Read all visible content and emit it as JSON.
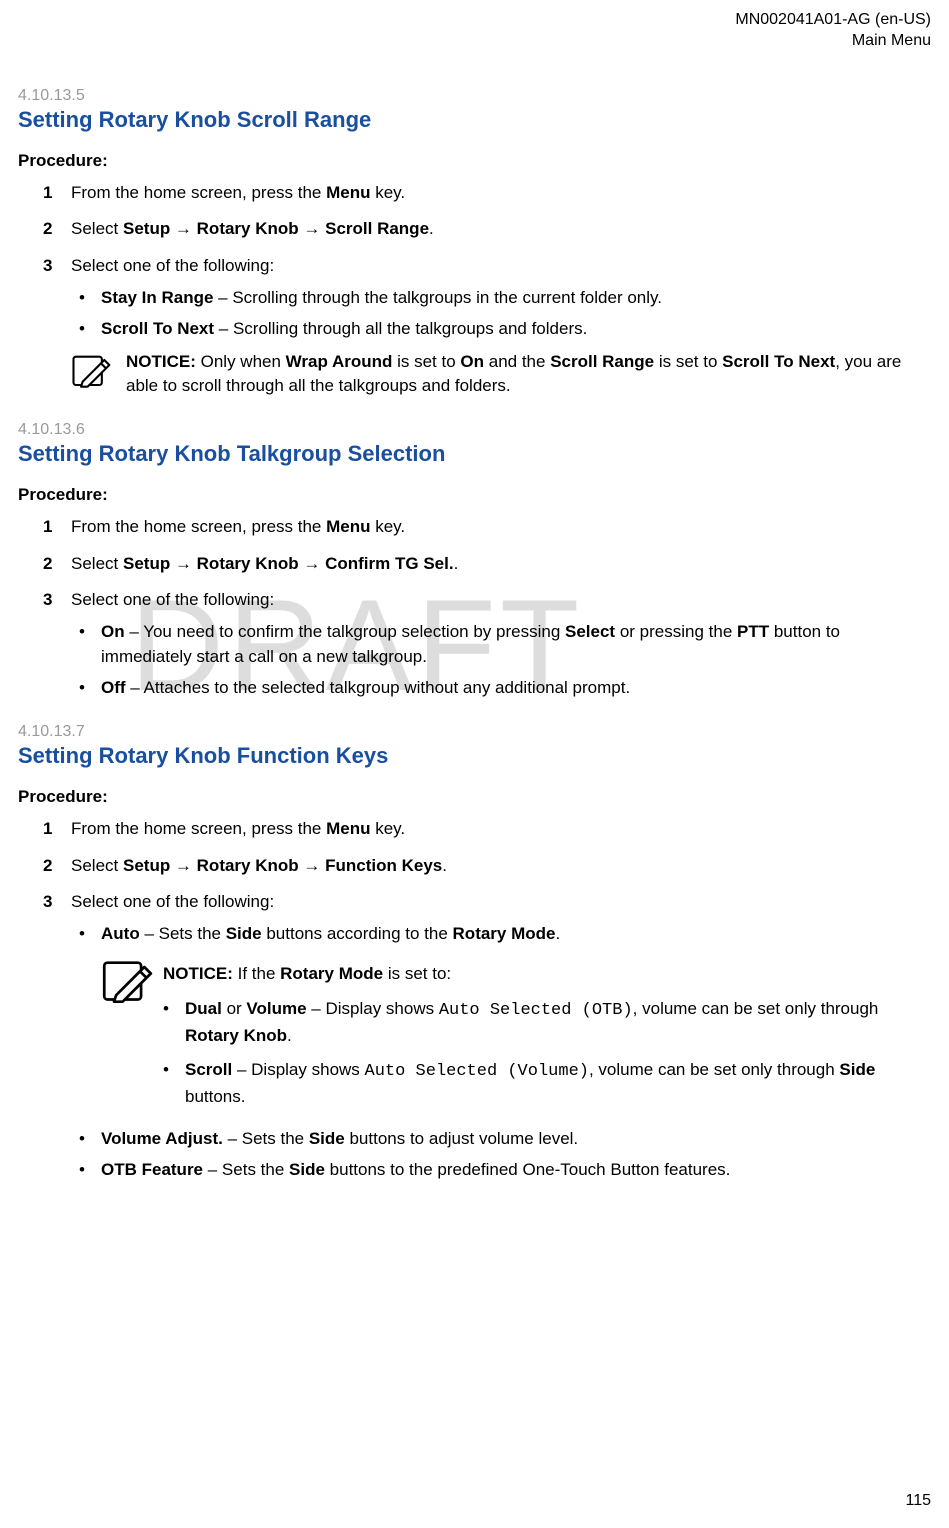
{
  "header": {
    "doc_id": "MN002041A01-AG (en-US)",
    "section": "Main Menu"
  },
  "watermark": "DRAFT",
  "page_number": "115",
  "sections": [
    {
      "num": "4.10.13.5",
      "title": "Setting Rotary Knob Scroll Range",
      "procedure_label": "Procedure:",
      "steps": [
        {
          "n": "1",
          "pre": "From the home screen, press the ",
          "bold1": "Menu",
          "post": " key."
        },
        {
          "n": "2",
          "pre": "Select ",
          "path": "Setup → Rotary Knob → Scroll Range",
          "post": "."
        },
        {
          "n": "3",
          "pre": "Select one of the following:"
        }
      ],
      "bullets": [
        {
          "bold": "Stay In Range",
          "rest": " – Scrolling through the talkgroups in the current folder only."
        },
        {
          "bold": "Scroll To Next",
          "rest": " – Scrolling through all the talkgroups and folders."
        }
      ],
      "notice": {
        "label": "NOTICE:",
        "t1": " Only when ",
        "b1": "Wrap Around",
        "t2": " is set to ",
        "b2": "On",
        "t3": " and the ",
        "b3": "Scroll Range",
        "t4": " is set to ",
        "b4": "Scroll To Next",
        "t5": ", you are able to scroll through all the talkgroups and folders."
      }
    },
    {
      "num": "4.10.13.6",
      "title": "Setting Rotary Knob Talkgroup Selection",
      "procedure_label": "Procedure:",
      "steps": [
        {
          "n": "1",
          "pre": "From the home screen, press the ",
          "bold1": "Menu",
          "post": " key."
        },
        {
          "n": "2",
          "pre": "Select ",
          "path": "Setup → Rotary Knob → Confirm TG Sel.",
          "post": "."
        },
        {
          "n": "3",
          "pre": "Select one of the following:"
        }
      ],
      "bullets": [
        {
          "bold": "On",
          "t1": " – You need to confirm the talkgroup selection by pressing ",
          "b1": "Select",
          "t2": " or pressing the ",
          "b2": "PTT",
          "t3": " button to immediately start a call on a new talkgroup."
        },
        {
          "bold": "Off",
          "rest": " – Attaches to the selected talkgroup without any additional prompt."
        }
      ]
    },
    {
      "num": "4.10.13.7",
      "title": "Setting Rotary Knob Function Keys",
      "procedure_label": "Procedure:",
      "steps": [
        {
          "n": "1",
          "pre": "From the home screen, press the ",
          "bold1": "Menu",
          "post": " key."
        },
        {
          "n": "2",
          "pre": "Select ",
          "path": "Setup → Rotary Knob → Function Keys",
          "post": "."
        },
        {
          "n": "3",
          "pre": "Select one of the following:"
        }
      ],
      "bullets_a": {
        "bold": "Auto",
        "t1": " – Sets the ",
        "b1": "Side",
        "t2": " buttons according to the ",
        "b2": "Rotary Mode",
        "t3": "."
      },
      "notice": {
        "label": "NOTICE:",
        "t1": " If the ",
        "b1": "Rotary Mode",
        "t2": " is set to:"
      },
      "inner_bullets": [
        {
          "b1": "Dual",
          "t1": " or ",
          "b2": "Volume",
          "t2": " – Display shows ",
          "mono": "Auto Selected (OTB)",
          "t3": ", volume can be set only through ",
          "b3": "Rotary Knob",
          "t4": "."
        },
        {
          "b1": "Scroll",
          "t1": " – Display shows ",
          "mono": "Auto Selected (Volume)",
          "t2": ", volume can be set only through ",
          "b2": "Side",
          "t3": " buttons."
        }
      ],
      "bullets_b": [
        {
          "bold": "Volume Adjust.",
          "t1": " – Sets the ",
          "b1": "Side",
          "t2": " buttons to adjust volume level."
        },
        {
          "bold": "OTB Feature",
          "t1": " – Sets the ",
          "b1": "Side",
          "t2": " buttons to the predefined One-Touch Button features."
        }
      ]
    }
  ]
}
